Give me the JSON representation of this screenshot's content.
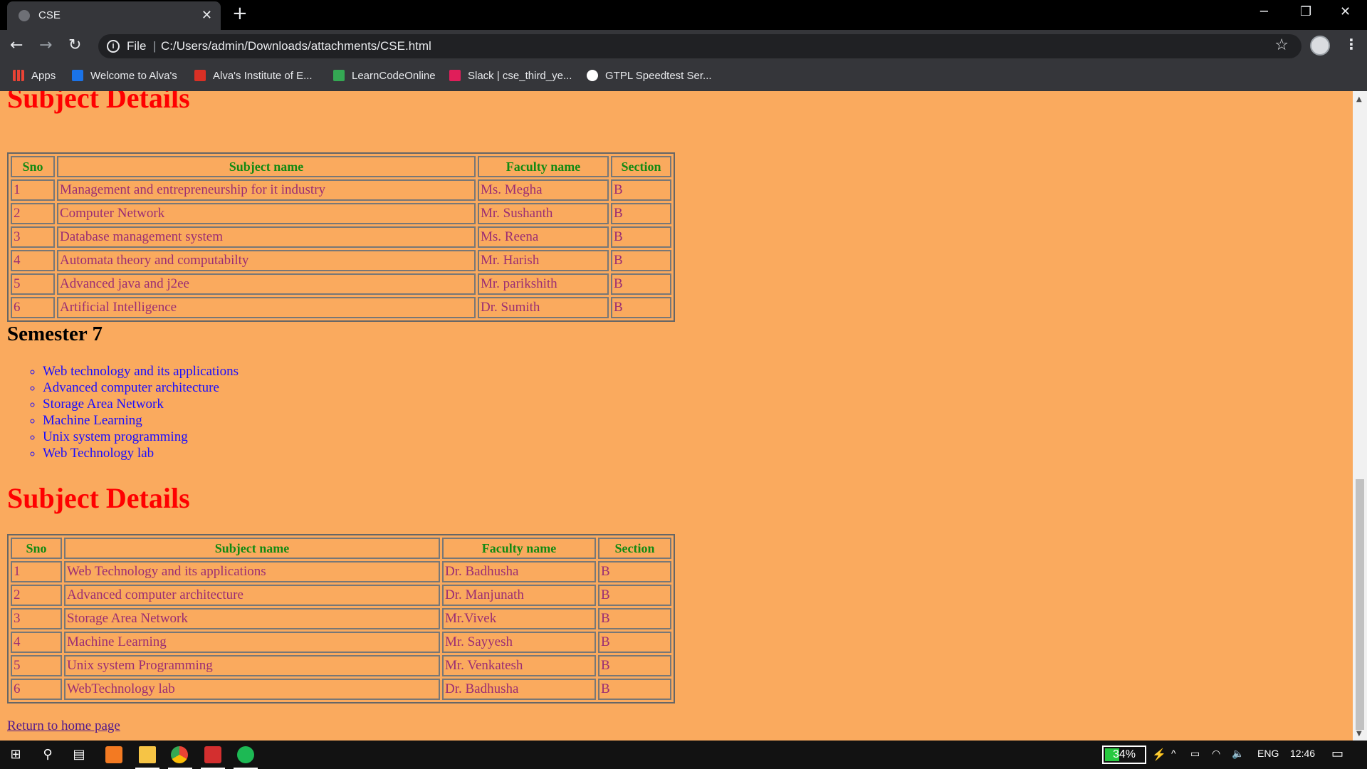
{
  "browser": {
    "tab_title": "CSE",
    "tab_close": "✕",
    "new_tab": "+",
    "address_scheme": "File",
    "address_separator": "|",
    "address_url": "C:/Users/admin/Downloads/attachments/CSE.html",
    "bookmarks": [
      {
        "label": "Apps",
        "icon": "apps-grid-icon",
        "color": "#ea4335"
      },
      {
        "label": "Welcome to Alva's",
        "icon": "s-logo-icon",
        "color": "#1a73e8"
      },
      {
        "label": "Alva's Institute of E...",
        "icon": "institute-icon",
        "color": "#d93025"
      },
      {
        "label": "LearnCodeOnline",
        "icon": "play-icon",
        "color": "#34a853"
      },
      {
        "label": "Slack | cse_third_ye...",
        "icon": "slack-icon",
        "color": "#e01e5a"
      },
      {
        "label": "GTPL Speedtest Ser...",
        "icon": "speedtest-icon",
        "color": "#ffffff"
      }
    ]
  },
  "page": {
    "top_details_heading": "Subject Details",
    "table_headers": [
      "Sno",
      "Subject name",
      "Faculty name",
      "Section"
    ],
    "table_sem6": [
      [
        "1",
        "Management and entrepreneurship for it industry",
        "Ms. Megha",
        "B"
      ],
      [
        "2",
        "Computer Network",
        "Mr. Sushanth",
        "B"
      ],
      [
        "3",
        "Database management system",
        "Ms. Reena",
        "B"
      ],
      [
        "4",
        "Automata theory and computabilty",
        "Mr. Harish",
        "B"
      ],
      [
        "5",
        "Advanced java and j2ee",
        "Mr. parikshith",
        "B"
      ],
      [
        "6",
        "Artificial Intelligence",
        "Dr. Sumith",
        "B"
      ]
    ],
    "semester7_heading": "Semester 7",
    "semester7_subjects": [
      "Web technology and its applications",
      "Advanced computer architecture",
      "Storage Area Network",
      "Machine Learning",
      "Unix system programming",
      "Web Technology lab"
    ],
    "bottom_details_heading": "Subject Details",
    "table_sem7": [
      [
        "1",
        "Web Technology and its applications",
        "Dr. Badhusha",
        "B"
      ],
      [
        "2",
        "Advanced computer architecture",
        "Dr. Manjunath",
        "B"
      ],
      [
        "3",
        "Storage Area Network",
        "Mr.Vivek",
        "B"
      ],
      [
        "4",
        "Machine Learning",
        "Mr. Sayyesh",
        "B"
      ],
      [
        "5",
        "Unix system Programming",
        "Mr. Venkatesh",
        "B"
      ],
      [
        "6",
        "WebTechnology lab",
        "Dr. Badhusha",
        "B"
      ]
    ],
    "home_link": "Return to home page",
    "colors": {
      "background": "#faaa5e",
      "heading": "#ff0000",
      "table_header": "#138a13",
      "table_cell": "#9b2d73",
      "list_link": "#1a0dff"
    }
  },
  "taskbar": {
    "battery": "34%",
    "language": "ENG",
    "time": "12:46"
  }
}
